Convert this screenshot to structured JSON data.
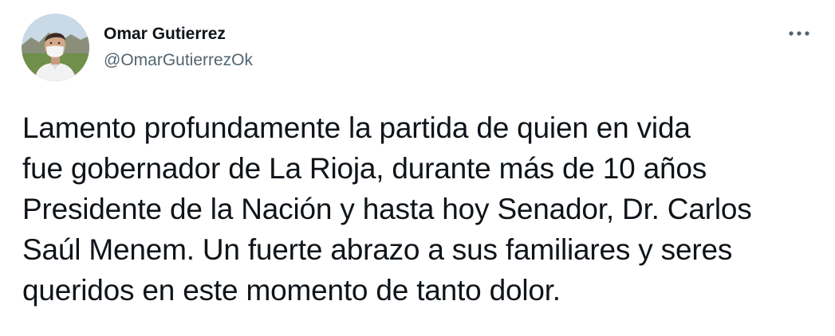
{
  "author": {
    "display_name": "Omar Gutierrez",
    "handle": "@OmarGutierrezOk",
    "avatar": "profile-photo"
  },
  "menu": {
    "icon": "more-horizontal-icon"
  },
  "tweet": {
    "text": "Lamento profundamente la partida de quien en vida\nfue gobernador de La Rioja, durante más de 10 años\nPresidente de la Nación y hasta hoy Senador, Dr. Carlos\nSaúl Menem. Un fuerte abrazo a sus familiares y seres\nqueridos en este momento de tanto dolor."
  },
  "colors": {
    "text_primary": "#0f1419",
    "text_secondary": "#536471",
    "background": "#ffffff"
  }
}
